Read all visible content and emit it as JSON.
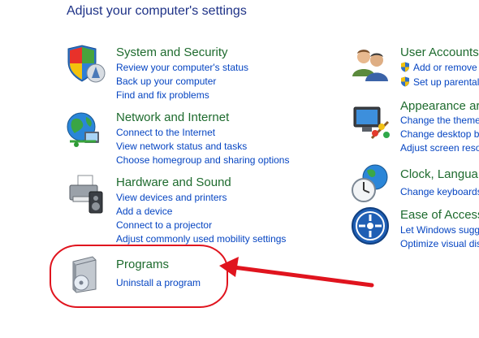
{
  "page": {
    "title": "Adjust your computer's settings"
  },
  "left": {
    "system_security": {
      "title": "System and Security",
      "links": [
        "Review your computer's status",
        "Back up your computer",
        "Find and fix problems"
      ]
    },
    "network": {
      "title": "Network and Internet",
      "links": [
        "Connect to the Internet",
        "View network status and tasks",
        "Choose homegroup and sharing options"
      ]
    },
    "hardware": {
      "title": "Hardware and Sound",
      "links": [
        "View devices and printers",
        "Add a device",
        "Connect to a projector",
        "Adjust commonly used mobility settings"
      ]
    },
    "programs": {
      "title": "Programs",
      "links": [
        "Uninstall a program"
      ]
    }
  },
  "right": {
    "user_accounts": {
      "title": "User Accounts",
      "links": [
        "Add or remove",
        "Set up parental"
      ]
    },
    "appearance": {
      "title": "Appearance ar",
      "links": [
        "Change the theme",
        "Change desktop b",
        "Adjust screen reso"
      ]
    },
    "clock": {
      "title": "Clock, Langua",
      "links": [
        "Change keyboards"
      ]
    },
    "ease": {
      "title": "Ease of Access",
      "links": [
        "Let Windows sugg",
        "Optimize visual dis"
      ]
    }
  },
  "colors": {
    "title": "#1e3287",
    "category": "#1e6b2e",
    "link": "#0645c2",
    "annotation": "#e0141e"
  }
}
